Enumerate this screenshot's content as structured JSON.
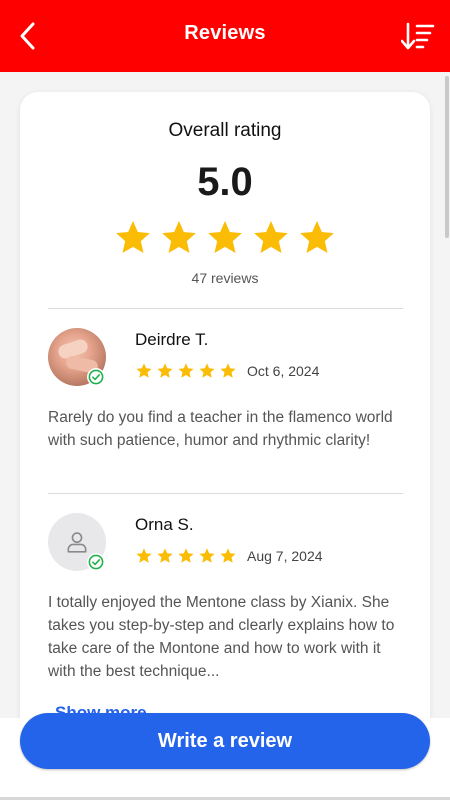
{
  "colors": {
    "header_bg": "#ff0000",
    "star": "#fbbc05",
    "accent_blue": "#2464ea",
    "verified_green": "#22b14c"
  },
  "header": {
    "title": "Reviews",
    "back_icon": "chevron-left-icon",
    "sort_icon": "sort-descending-icon"
  },
  "summary": {
    "label": "Overall rating",
    "score": "5.0",
    "stars": 5,
    "count_text": "47 reviews"
  },
  "reviews": [
    {
      "name": "Deirdre T.",
      "avatar": "photo-avatar",
      "verified": true,
      "stars": 5,
      "date": "Oct 6, 2024",
      "text": "Rarely do you find a teacher in the flamenco world with such patience, humor and rhythmic clarity!"
    },
    {
      "name": "Orna S.",
      "avatar": "user-placeholder-icon",
      "verified": true,
      "stars": 5,
      "date": "Aug 7, 2024",
      "text": "I totally enjoyed the Mentone class by Xianix. She takes you step-by-step and clearly explains how to take care of the Montone and how to work with it with the best technique..."
    }
  ],
  "show_more_label": "Show more",
  "write_review_label": "Write a review"
}
